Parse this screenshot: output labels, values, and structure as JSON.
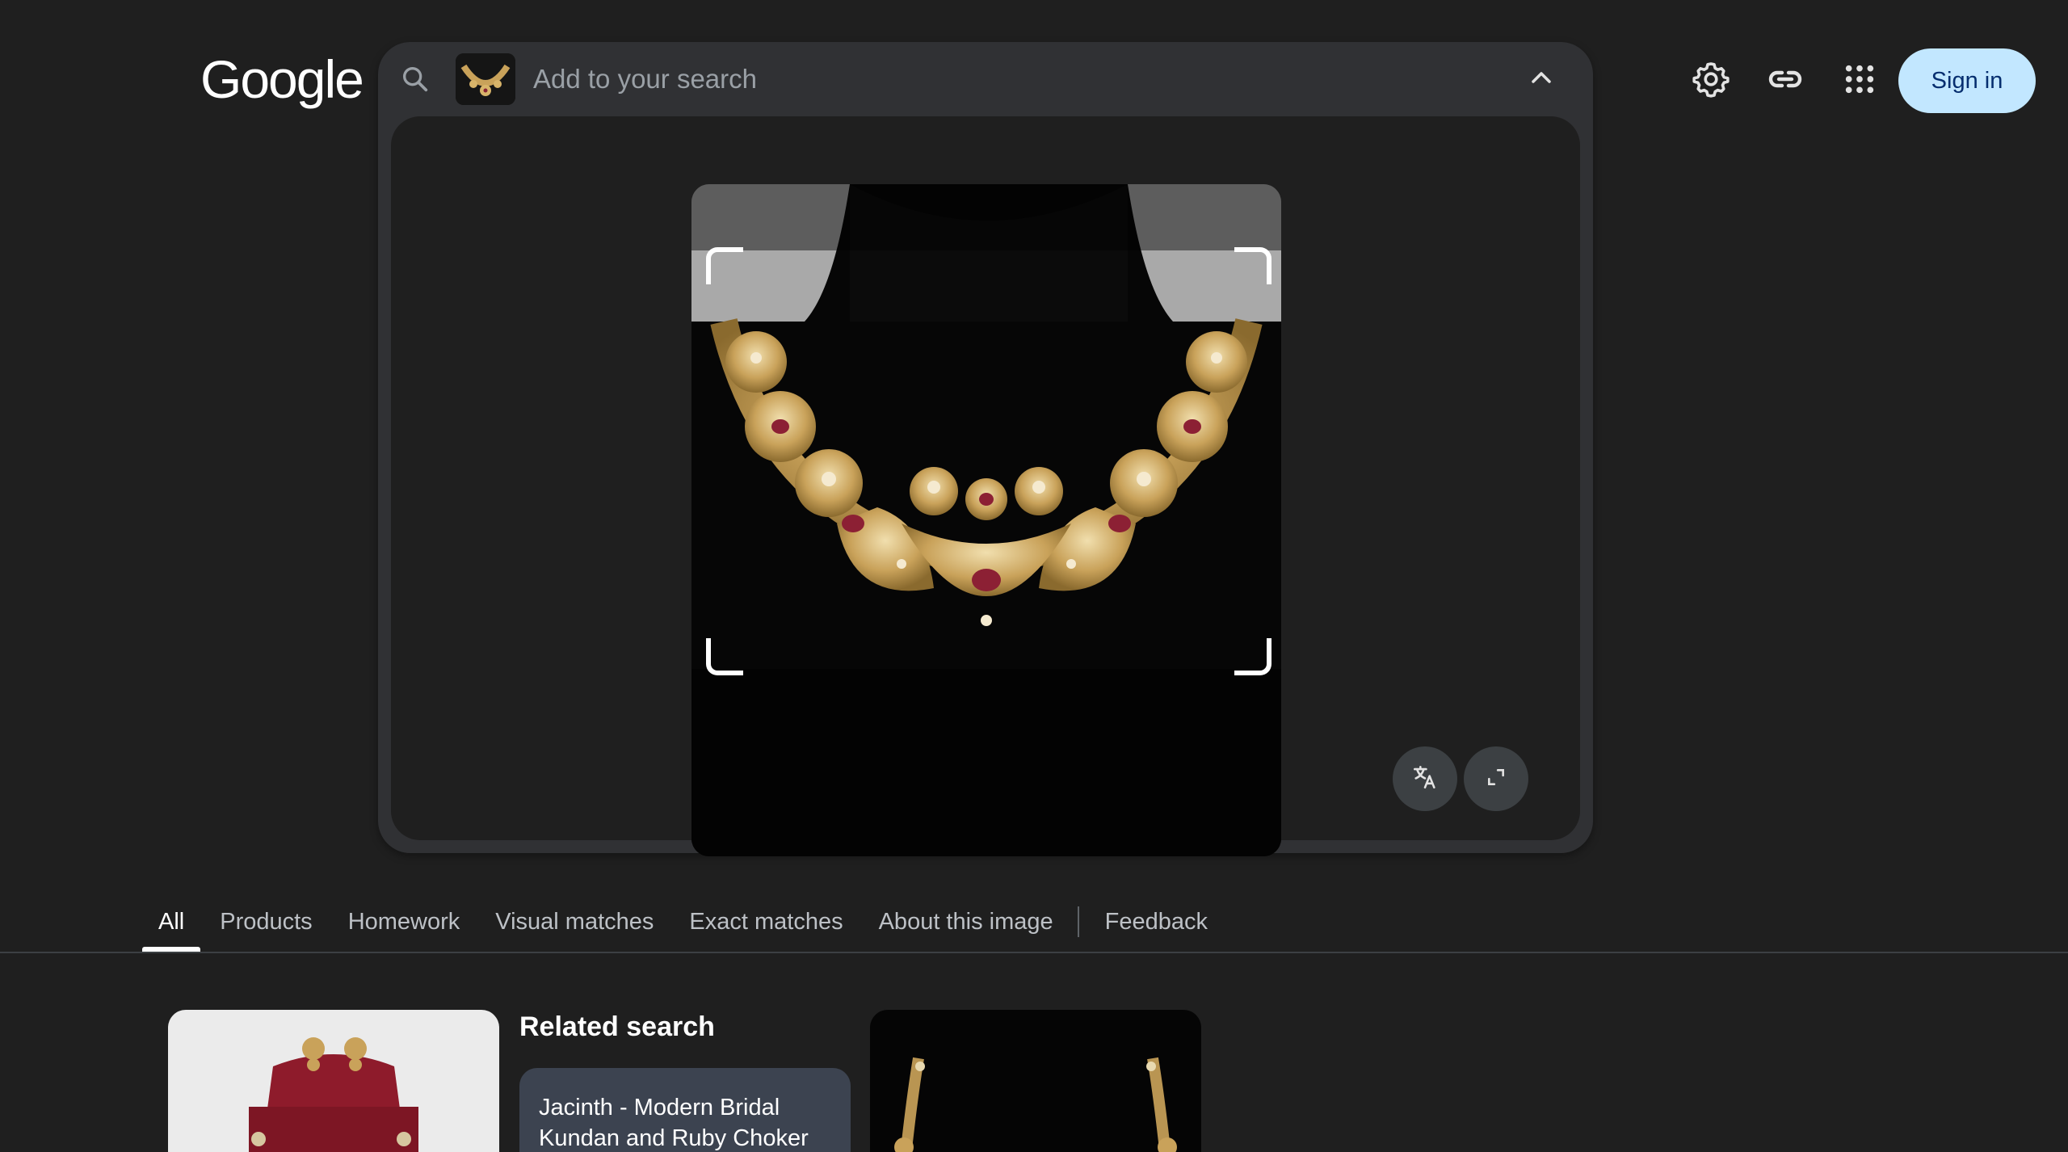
{
  "header": {
    "logo_text": "Google",
    "sign_in_label": "Sign in",
    "icons": [
      "gear-icon",
      "link-icon",
      "apps-grid-icon"
    ]
  },
  "search": {
    "placeholder": "Add to your search",
    "value": ""
  },
  "image_tools": [
    "translate-icon",
    "expand-icon"
  ],
  "tabs": [
    {
      "label": "All",
      "active": true
    },
    {
      "label": "Products"
    },
    {
      "label": "Homework"
    },
    {
      "label": "Visual matches"
    },
    {
      "label": "Exact matches"
    },
    {
      "label": "About this image"
    },
    {
      "label": "Feedback"
    }
  ],
  "results": {
    "related_title": "Related search",
    "related_chip": "Jacinth - Modern Bridal Kundan and Ruby Choker"
  },
  "colors": {
    "background": "#1f1f1f",
    "panel": "#303134",
    "sign_in_bg": "#c2e7ff",
    "sign_in_text": "#062e6f",
    "chip": "#3c4350"
  }
}
